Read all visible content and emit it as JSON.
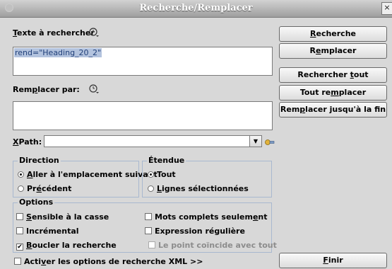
{
  "window": {
    "title": "Recherche/Remplacer",
    "close_glyph": "×"
  },
  "search": {
    "label_u": "T",
    "label_rest": "exte à rechercher",
    "value": "rend=\"Heading_20_2\""
  },
  "replace": {
    "label_a": "Rem",
    "label_u": "p",
    "label_b": "lacer par:",
    "value": ""
  },
  "xpath": {
    "label_u": "X",
    "label_rest": "Path:",
    "value": ""
  },
  "buttons": {
    "recherche": {
      "u": "R",
      "rest": "echerche"
    },
    "remplacer": {
      "a": "R",
      "u": "e",
      "b": "mplacer"
    },
    "rechercher_tout": {
      "a": "Rechercher ",
      "u": "t",
      "b": "out"
    },
    "tout_remplacer": {
      "a": "Tout re",
      "u": "m",
      "b": "placer"
    },
    "remplacer_jusqua": {
      "a": "Rem",
      "u": "p",
      "b": "lacer jusqu'à la fin"
    },
    "finir": {
      "u": "F",
      "rest": "inir"
    }
  },
  "direction": {
    "title": "Direction",
    "opt1": {
      "u": "A",
      "rest": "ller à l'emplacement suivant",
      "checked": true
    },
    "opt2": {
      "a": "Pr",
      "u": "é",
      "b": "cédent",
      "checked": false
    }
  },
  "etendue": {
    "title": "Étendue",
    "opt1": {
      "label": "Tout",
      "checked": true
    },
    "opt2": {
      "u": "L",
      "rest": "ignes sélectionnées",
      "checked": false
    }
  },
  "options": {
    "title": "Options",
    "casse": {
      "u": "S",
      "rest": "ensible à la casse",
      "checked": false
    },
    "mots": {
      "a": "Mots complets seulem",
      "u": "e",
      "b": "nt",
      "checked": false
    },
    "incremental": {
      "label": "Incrémental",
      "checked": false
    },
    "regexp": {
      "label": "Expression régulière",
      "checked": false
    },
    "boucler": {
      "u": "B",
      "rest": "oucler la recherche",
      "checked": true
    },
    "point": {
      "label": "Le point coïncide avec tout",
      "checked": false,
      "disabled": true
    }
  },
  "xml": {
    "a": "Acti",
    "u": "v",
    "b": "er les options de recherche XML >>",
    "checked": false
  },
  "icons": {
    "history": "history-dropdown-icon",
    "xpath_tool": "xpath-tool-icon",
    "check_mark": "✔"
  }
}
